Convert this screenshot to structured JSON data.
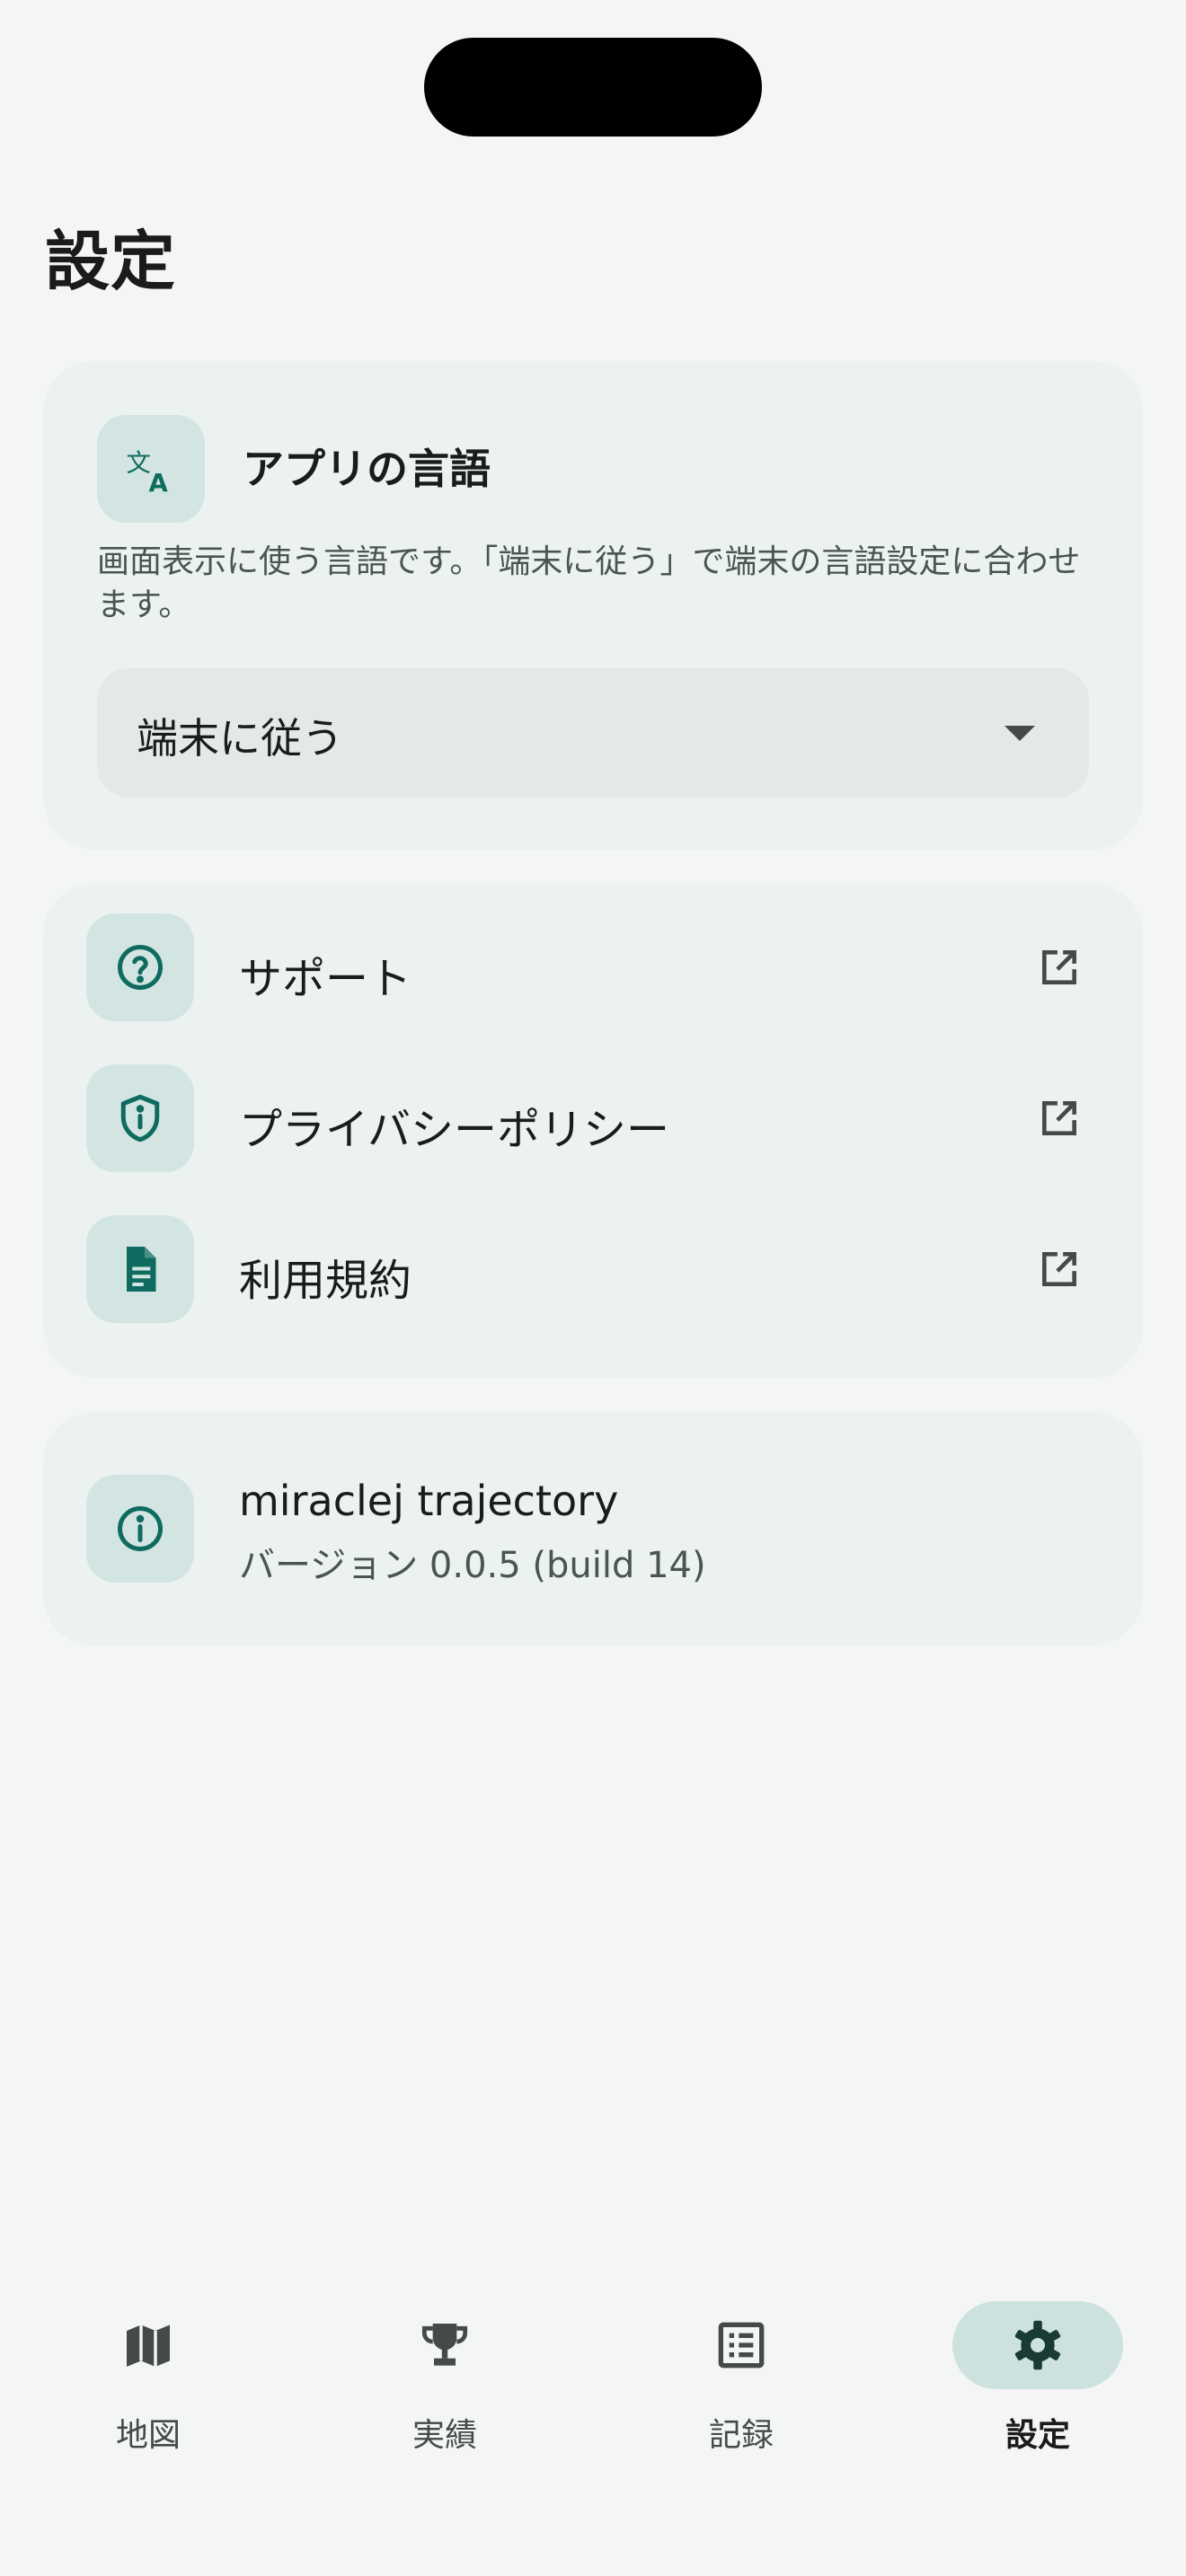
{
  "page": {
    "title": "設定"
  },
  "language_card": {
    "title": "アプリの言語",
    "description": "画面表示に使う言語です。「端末に従う」で端末の言語設定に合わせます。",
    "selected_value": "端末に従う",
    "icon": "translate-icon"
  },
  "links": [
    {
      "label": "サポート",
      "icon": "help-circle-icon"
    },
    {
      "label": "プライバシーポリシー",
      "icon": "shield-info-icon"
    },
    {
      "label": "利用規約",
      "icon": "document-icon"
    }
  ],
  "about": {
    "app_name": "miraclej trajectory",
    "version": "バージョン 0.0.5 (build 14)",
    "icon": "info-icon"
  },
  "tabs": [
    {
      "label": "地図",
      "icon": "map-icon",
      "active": false
    },
    {
      "label": "実績",
      "icon": "trophy-icon",
      "active": false
    },
    {
      "label": "記録",
      "icon": "list-icon",
      "active": false
    },
    {
      "label": "設定",
      "icon": "gear-icon",
      "active": true
    }
  ],
  "colors": {
    "accent": "#0f6b60",
    "background": "#f4f6f5",
    "card": "#ecf2f0",
    "icon_tile": "#d3e5e2",
    "active_tab_pill": "#cde2de"
  }
}
